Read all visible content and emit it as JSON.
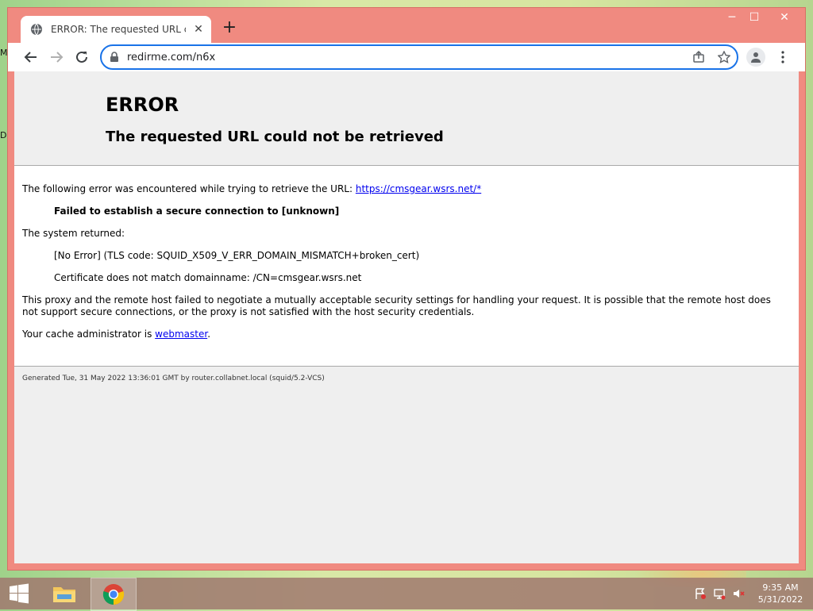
{
  "desktop": {
    "edge_letters": [
      "M",
      "D"
    ]
  },
  "window_controls": {
    "minimize": "─",
    "maximize": "☐",
    "close": "✕"
  },
  "tab": {
    "title": "ERROR: The requested URL could",
    "close_glyph": "✕"
  },
  "newtab_glyph": "+",
  "toolbar": {
    "back_icon": "arrow-left-icon",
    "forward_icon": "arrow-right-icon",
    "reload_icon": "reload-icon",
    "url": "redirme.com/n6x"
  },
  "page": {
    "h1": "ERROR",
    "h2": "The requested URL could not be retrieved",
    "intro": "The following error was encountered while trying to retrieve the URL: ",
    "intro_link": "https://cmsgear.wsrs.net/*",
    "failure": "Failed to establish a secure connection to [unknown]",
    "system_returned": "The system returned:",
    "tls_code": "[No Error] (TLS code: SQUID_X509_V_ERR_DOMAIN_MISMATCH+broken_cert)",
    "cert_mismatch": "Certificate does not match domainname: /CN=cmsgear.wsrs.net",
    "explanation": "This proxy and the remote host failed to negotiate a mutually acceptable security settings for handling your request. It is possible that the remote host does not support secure connections, or the proxy is not satisfied with the host security credentials.",
    "admin_prefix": "Your cache administrator is ",
    "admin_link": "webmaster",
    "admin_suffix": ".",
    "footer": "Generated Tue, 31 May 2022 13:36:01 GMT by router.collabnet.local (squid/5.2-VCS)"
  },
  "taskbar": {
    "time": "9:35 AM",
    "date": "5/31/2022"
  },
  "colors": {
    "frame": "#f08a80",
    "omnibox_border": "#1a73e8",
    "link": "#0000ee"
  }
}
